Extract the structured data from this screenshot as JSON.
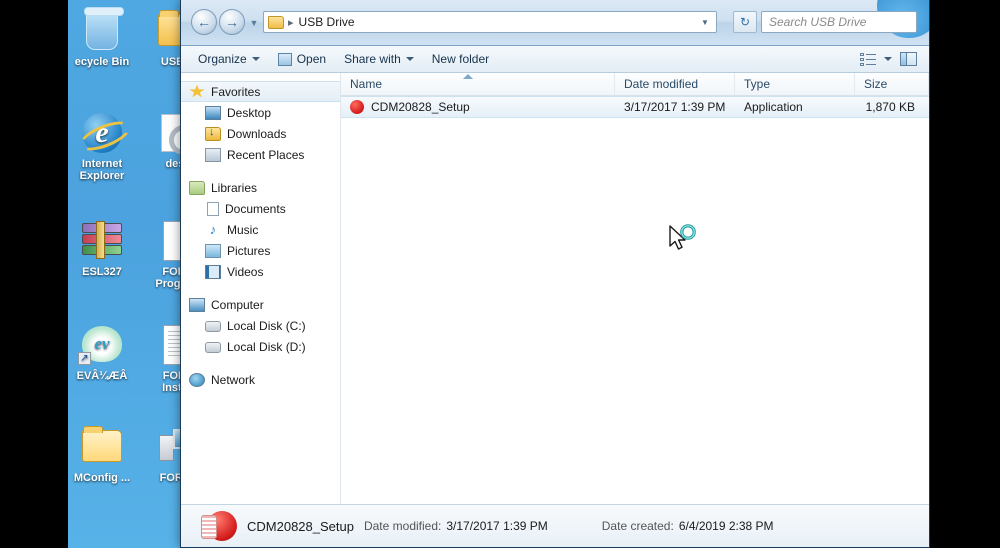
{
  "desktop": {
    "icons": [
      {
        "name": "recycle-bin",
        "label": "ecycle Bin",
        "art": "bin"
      },
      {
        "name": "usb-drive-folder",
        "label": "USB D",
        "art": "folder-red"
      },
      {
        "name": "internet-explorer",
        "label": "Internet\nExplorer",
        "art": "ie"
      },
      {
        "name": "desktop-ini",
        "label": "desk",
        "art": "gear"
      },
      {
        "name": "esl327-archive",
        "label": "ESL327",
        "art": "rar"
      },
      {
        "name": "ford-program",
        "label": "FORD\nProgram",
        "art": "doc"
      },
      {
        "name": "forscan-shortcut",
        "label": "EVÂ¼ÆÂ",
        "art": "leaf"
      },
      {
        "name": "forscan-installer",
        "label": "FORS\nInstall",
        "art": "doc-lined"
      },
      {
        "name": "vmconfig-folder",
        "label": "MConfig ...",
        "art": "folder-open"
      },
      {
        "name": "forscan-app",
        "label": "FORSc",
        "art": "monitor"
      }
    ]
  },
  "window": {
    "nav": {
      "back_icon": "←",
      "forward_icon": "→",
      "history_icon": "▼"
    },
    "address": {
      "separator": "▸",
      "path": "USB Drive",
      "dropdown_icon": "▼",
      "refresh_icon": "↻"
    },
    "search": {
      "placeholder": "Search USB Drive"
    },
    "toolbar": {
      "organize_label": "Organize",
      "open_label": "Open",
      "share_label": "Share with",
      "new_folder_label": "New folder",
      "view_dropdown_icon": "▼"
    },
    "sidebar": {
      "sections": [
        {
          "header": "Favorites",
          "header_icon": "i-star",
          "selected": true,
          "items": [
            {
              "label": "Desktop",
              "icon": "i-desktop"
            },
            {
              "label": "Downloads",
              "icon": "i-down"
            },
            {
              "label": "Recent Places",
              "icon": "i-recent"
            }
          ]
        },
        {
          "header": "Libraries",
          "header_icon": "i-lib",
          "selected": false,
          "items": [
            {
              "label": "Documents",
              "icon": "i-doc"
            },
            {
              "label": "Music",
              "icon": "i-music",
              "glyph": "♪"
            },
            {
              "label": "Pictures",
              "icon": "i-pic"
            },
            {
              "label": "Videos",
              "icon": "i-vid"
            }
          ]
        },
        {
          "header": "Computer",
          "header_icon": "i-comp",
          "selected": false,
          "items": [
            {
              "label": "Local Disk (C:)",
              "icon": "i-disk"
            },
            {
              "label": "Local Disk (D:)",
              "icon": "i-disk"
            }
          ]
        },
        {
          "header": "Network",
          "header_icon": "i-net",
          "selected": false,
          "items": []
        }
      ]
    },
    "columns": [
      {
        "label": "Name",
        "key": "name"
      },
      {
        "label": "Date modified",
        "key": "modified"
      },
      {
        "label": "Type",
        "key": "type"
      },
      {
        "label": "Size",
        "key": "size"
      }
    ],
    "files": [
      {
        "name": "CDM20828_Setup",
        "modified": "3/17/2017 1:39 PM",
        "type": "Application",
        "size": "1,870 KB",
        "icon": "application-icon",
        "selected": true
      }
    ],
    "details_pane": {
      "file_name": "CDM20828_Setup",
      "date_modified_label": "Date modified:",
      "date_modified_value": "3/17/2017 1:39 PM",
      "date_created_label": "Date created:",
      "date_created_value": "6/4/2019 2:38 PM"
    }
  },
  "cursor": {
    "name": "busy-pointer"
  }
}
